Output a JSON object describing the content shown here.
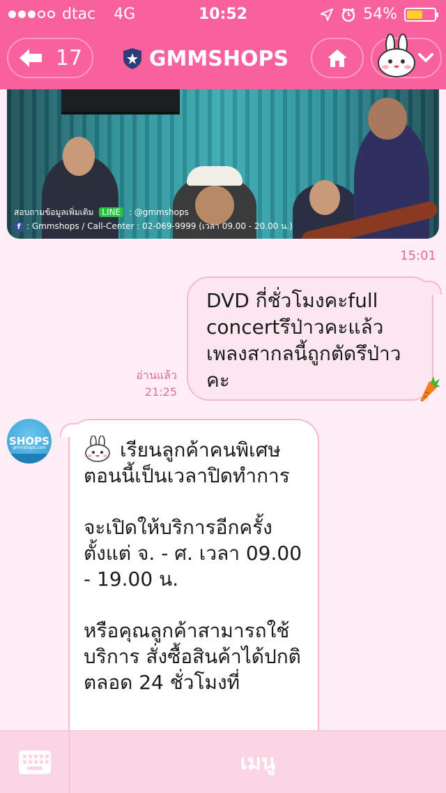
{
  "status_bar": {
    "carrier": "dtac",
    "network": "4G",
    "time": "10:52",
    "battery_percent": "54%",
    "battery_level": 0.54
  },
  "header": {
    "back_count": "17",
    "title": "GMMSHOPS",
    "accent_color": "#f9619d"
  },
  "banner": {
    "info_line1_prefix": "สอบถามข้อมูลเพิ่มเติม",
    "info_line1_badge": "LINE",
    "info_line1_handle": ": @gmmshops",
    "info_line2": ": Gmmshops / Call-Center : 02-069-9999 (เวลา 09.00 - 20.00 น.)",
    "time": "15:01"
  },
  "messages": [
    {
      "direction": "out",
      "text": "DVD กี่ชั่วโมงคะfull concertรึป่าวคะแล้วเพลงสากลนี้ถูกตัดรึป่าวคะ",
      "read_label": "อ่านแล้ว",
      "time": "21:25"
    },
    {
      "direction": "in",
      "sender_avatar_text": "SHOPS",
      "sender_avatar_sub": "gmmshops.com",
      "paragraphs": [
        "เรียนลูกค้าคนพิเศษ ตอนนี้เป็นเวลาปิดทำการ",
        "จะเปิดให้บริการอีกครั้งตั้งแต่ จ. - ศ. เวลา 09.00 - 19.00 น.",
        "หรือคุณลูกค้าสามารถใช้บริการ สั่งซื้อสินค้าได้ปกติตลอด 24 ชั่วโมงที่"
      ]
    }
  ],
  "bottom_bar": {
    "menu_label": "เมนู"
  }
}
